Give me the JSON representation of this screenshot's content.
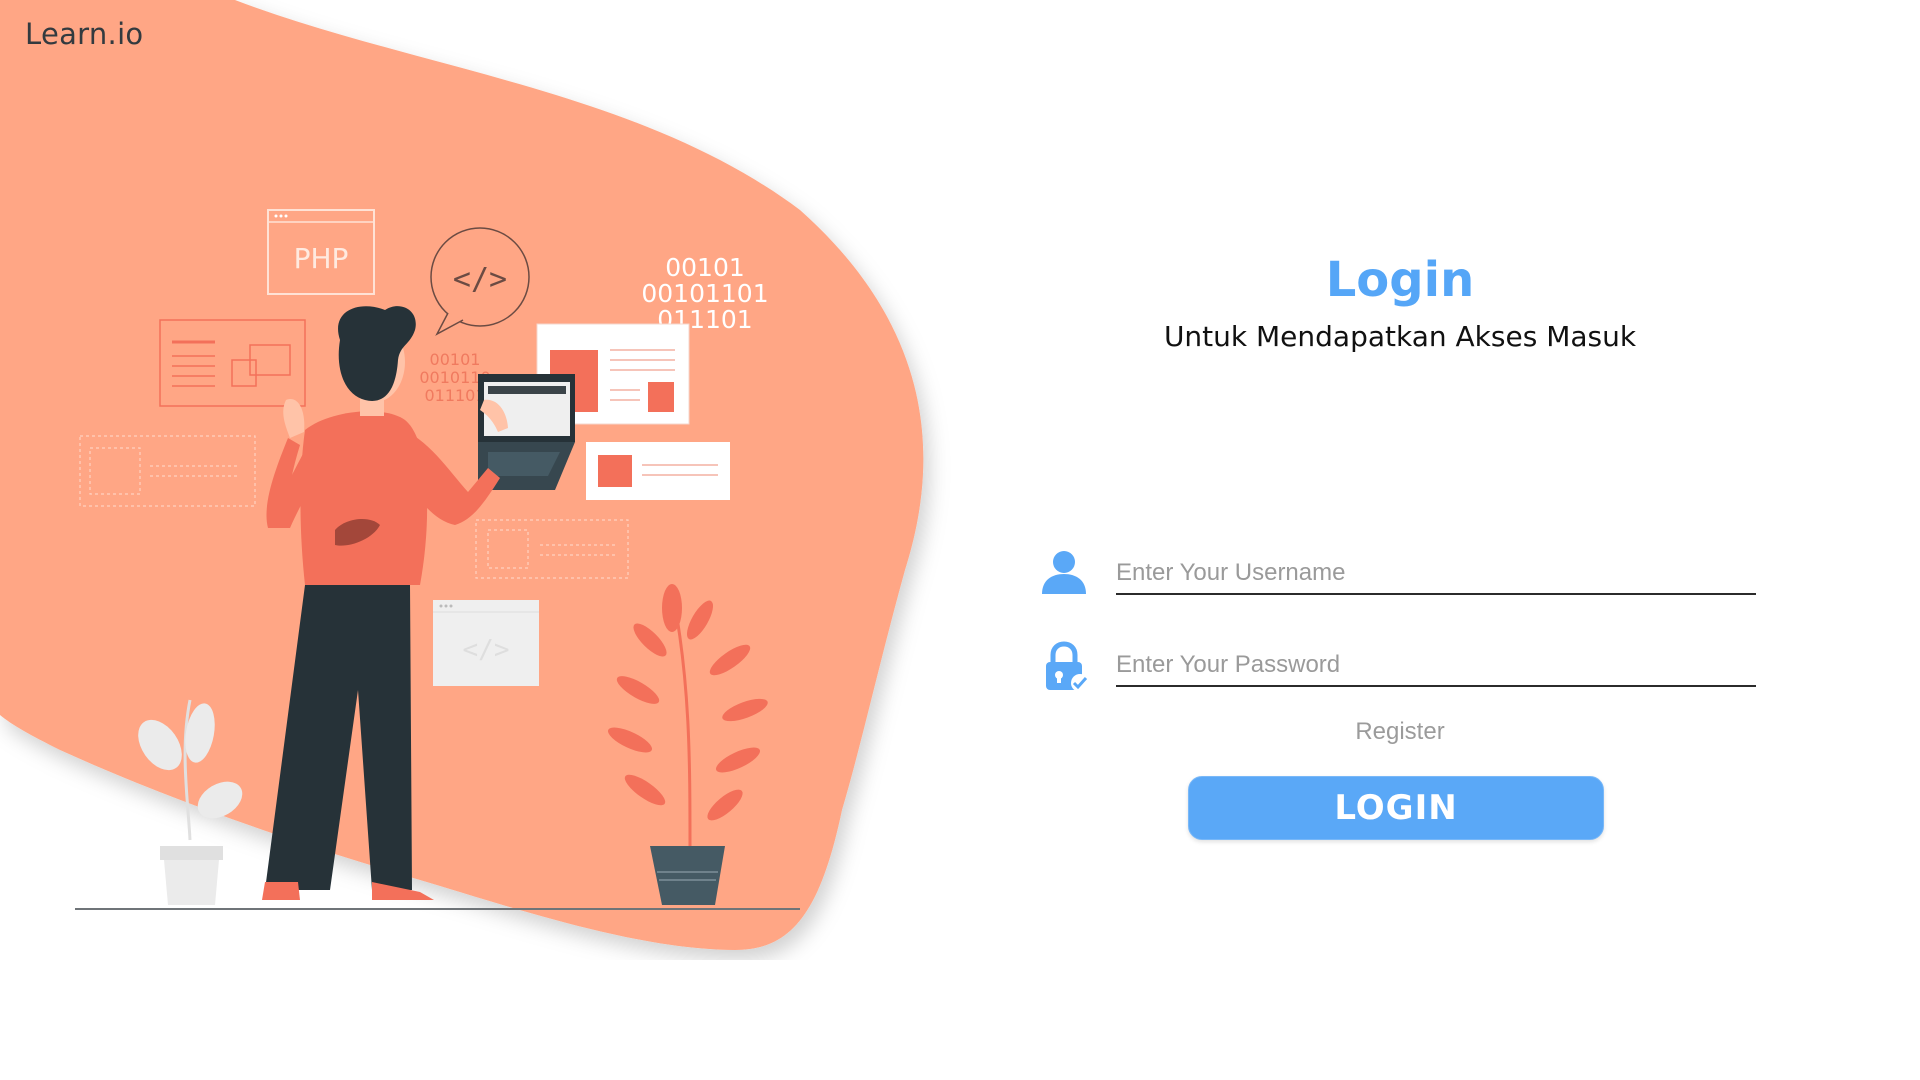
{
  "brand": {
    "logo_text": "Learn.io"
  },
  "colors": {
    "blob": "#ffa685",
    "accent": "#5aa8f7",
    "illustration_red": "#f3705a",
    "dark": "#263238"
  },
  "illustration": {
    "php_label": "PHP",
    "code_glyph": "</>",
    "binary_right": [
      "00101",
      "00101101",
      "011101"
    ],
    "binary_left": [
      "00101",
      "0010110",
      "011101"
    ]
  },
  "login_form": {
    "title": "Login",
    "subtitle": "Untuk Mendapatkan Akses Masuk",
    "username": {
      "placeholder": "Enter Your Username",
      "value": "",
      "icon": "user-icon"
    },
    "password": {
      "placeholder": "Enter Your Password",
      "value": "",
      "icon": "lock-check-icon"
    },
    "register_label": "Register",
    "login_label": "LOGIN"
  }
}
